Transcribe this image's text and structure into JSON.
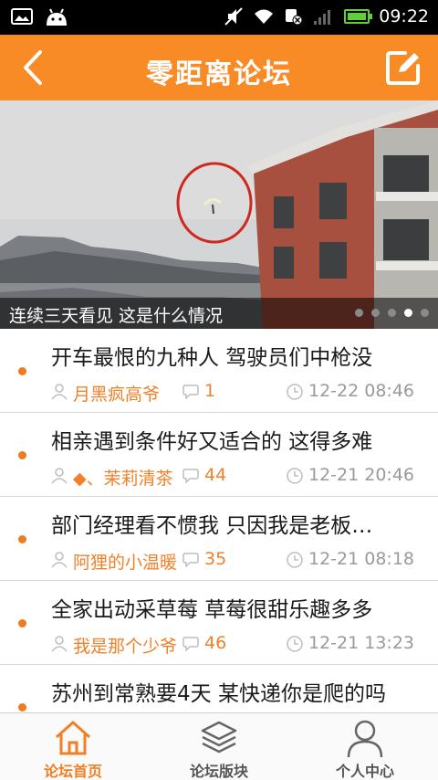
{
  "status_bar": {
    "time": "09:22",
    "battery_level": 1.0
  },
  "header": {
    "title": "零距离论坛"
  },
  "banner": {
    "caption": "连续三天看见 这是什么情况",
    "slide_count": 5,
    "active_index": 3
  },
  "posts": [
    {
      "title": "开车最恨的九种人 驾驶员们中枪没",
      "author": "月黑疯高爷",
      "comments": "1",
      "time": "12-22 08:46"
    },
    {
      "title": "相亲遇到条件好又适合的 这得多难",
      "author": "◆、茉莉清茶",
      "comments": "44",
      "time": "12-21 20:46"
    },
    {
      "title": "部门经理看不惯我 只因我是老板…",
      "author": "阿狸的小温暖",
      "comments": "35",
      "time": "12-21 08:18"
    },
    {
      "title": "全家出动采草莓 草莓很甜乐趣多多",
      "author": "我是那个少爷",
      "comments": "46",
      "time": "12-21 13:23"
    },
    {
      "title": "苏州到常熟要4天 某快递你是爬的吗",
      "author": "",
      "comments": "",
      "time": ""
    }
  ],
  "bottom_nav": [
    {
      "label": "论坛首页",
      "icon": "home-icon",
      "active": true
    },
    {
      "label": "论坛版块",
      "icon": "layers-icon",
      "active": false
    },
    {
      "label": "个人中心",
      "icon": "person-icon",
      "active": false
    }
  ],
  "colors": {
    "accent": "#f98b26",
    "author": "#f0812a",
    "meta_gray": "#9a9a9a"
  }
}
